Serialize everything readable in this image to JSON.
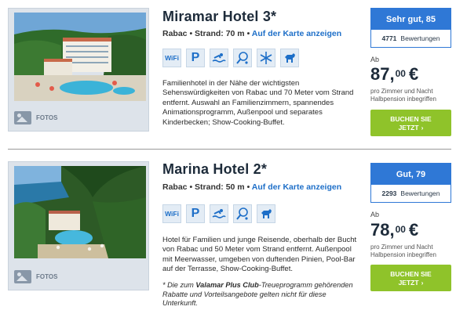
{
  "fotos_label": "FOTOS",
  "hotels": [
    {
      "name": "Miramar Hotel 3*",
      "location": "Rabac",
      "beach": "Strand: 70 m",
      "map_link": "Auf der Karte anzeigen",
      "amenities": [
        "WiFi",
        "parking-icon",
        "pool-icon",
        "tennis-icon",
        "air-conditioning-icon",
        "pets-icon"
      ],
      "description": "Familienhotel in der Nähe der wichtigsten Sehenswürdigkeiten von Rabac und 70 Meter vom Strand entfernt. Auswahl an Familienzimmern, spannendes Animationsprogramm, Außenpool und separates Kinderbecken; Show-Cooking-Buffet.",
      "rating": "Sehr gut, 85",
      "reviews_count": "4771",
      "reviews_label": "Bewertungen",
      "price_prefix": "Ab",
      "price_main": "87,",
      "price_cents": "00",
      "currency": "€",
      "price_note": "pro Zimmer und Nacht Halbpension inbegriffen",
      "book_line1": "BUCHEN SIE",
      "book_line2": "JETZT"
    },
    {
      "name": "Marina Hotel 2*",
      "location": "Rabac",
      "beach": "Strand: 50 m",
      "map_link": "Auf der Karte anzeigen",
      "amenities": [
        "WiFi",
        "parking-icon",
        "pool-icon",
        "tennis-icon",
        "pets-icon"
      ],
      "description": "Hotel für Familien und junge Reisende, oberhalb der Bucht von Rabac und 50 Meter vom Strand entfernt. Außenpool mit Meerwasser, umgeben von duftenden Pinien, Pool-Bar auf der Terrasse, Show-Cooking-Buffet.",
      "note_prefix": "* Die zum ",
      "note_brand": "Valamar Plus Club",
      "note_suffix": "-Treueprogramm gehörenden Rabatte und Vorteilsangebote gelten nicht für diese Unterkunft.",
      "rating": "Gut, 79",
      "reviews_count": "2293",
      "reviews_label": "Bewertungen",
      "price_prefix": "Ab",
      "price_main": "78,",
      "price_cents": "00",
      "currency": "€",
      "price_note": "pro Zimmer und Nacht Halbpension inbegriffen",
      "book_line1": "BUCHEN SIE",
      "book_line2": "JETZT"
    }
  ],
  "colors": {
    "accent_blue": "#2f78d6",
    "link_blue": "#1e6fc8",
    "book_green": "#8fc32a",
    "title_dark": "#1d2b3a"
  }
}
